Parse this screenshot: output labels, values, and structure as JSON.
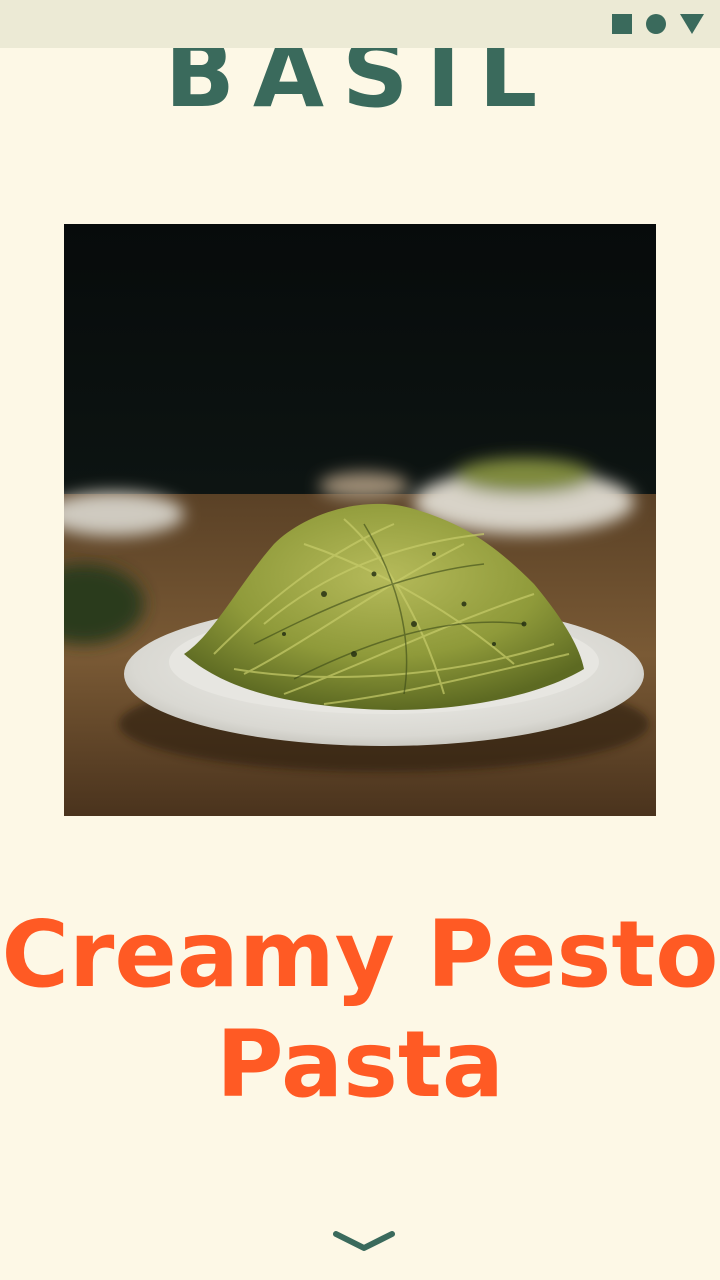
{
  "brand": {
    "title": "BASIL"
  },
  "status_bar": {
    "icons": [
      "square-icon",
      "circle-icon",
      "triangle-icon"
    ]
  },
  "recipe": {
    "title_line1": "Creamy Pesto",
    "title_line2": "Pasta"
  },
  "photo": {
    "alt": "Plate of pesto spaghetti on a wooden table"
  },
  "colors": {
    "brand": "#3a6a5c",
    "title": "#ff5a24",
    "background": "#fdf8e6",
    "status_bar": "#ecead5"
  },
  "scroll_hint": {
    "icon": "chevron-down-icon"
  }
}
